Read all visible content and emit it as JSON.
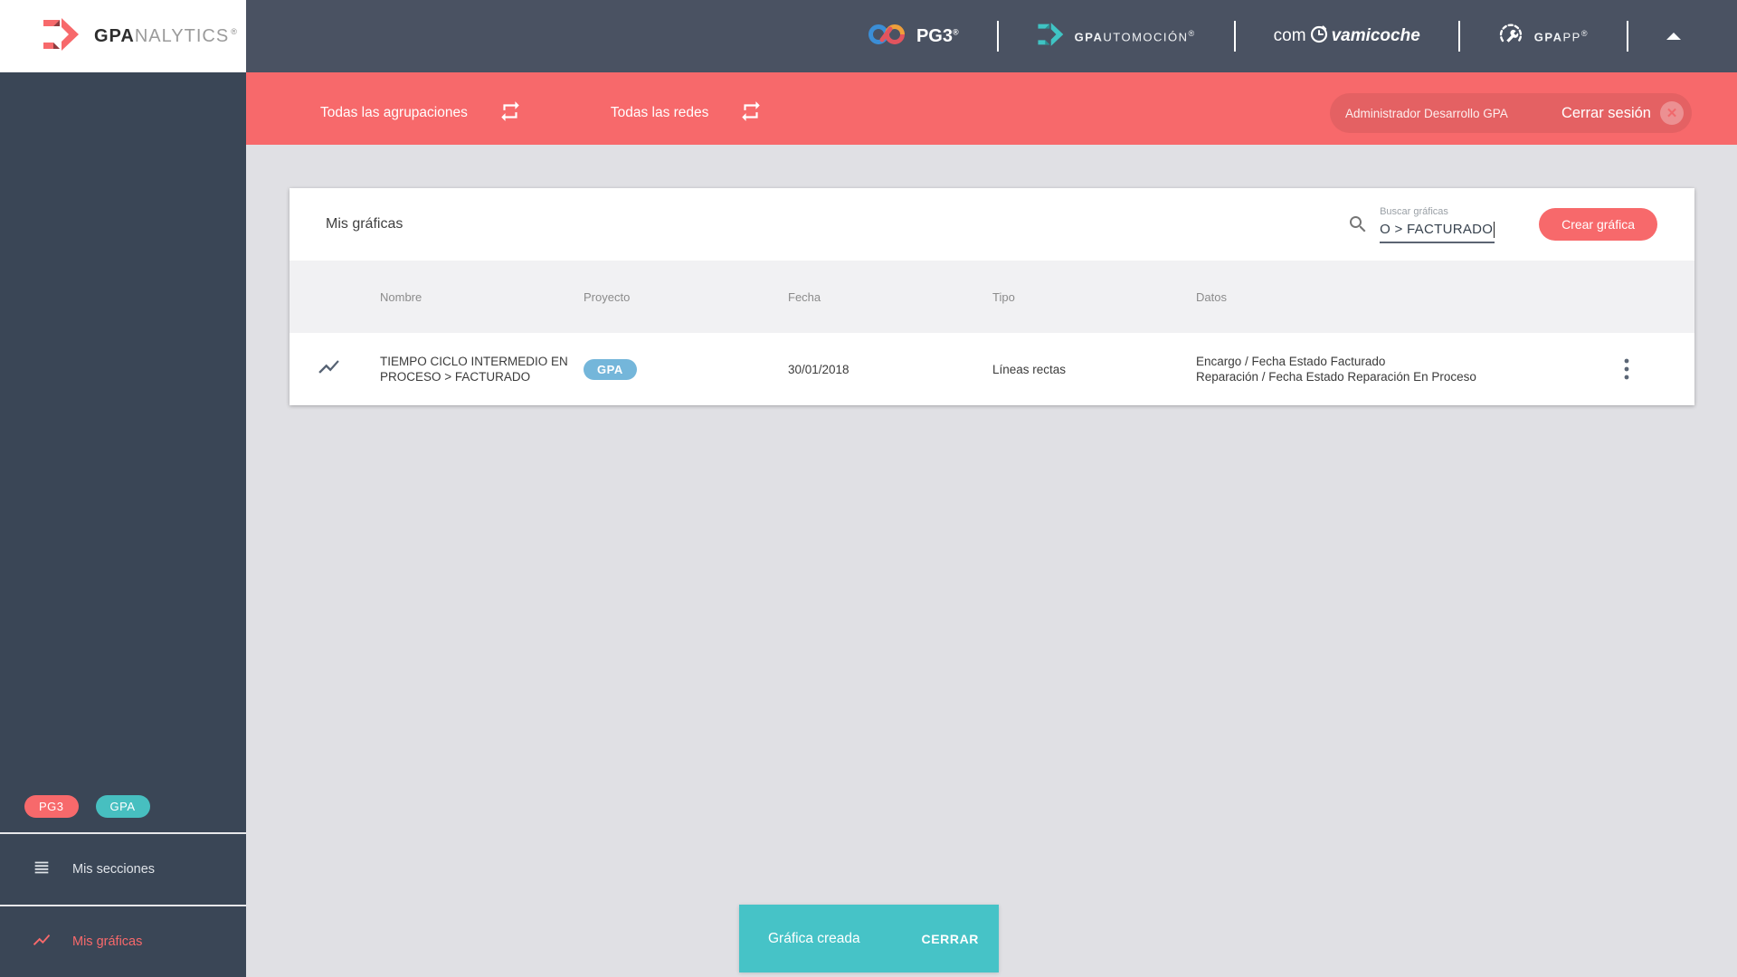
{
  "topbar": {
    "brand": {
      "bold": "GPA",
      "rest": "NALYTICS",
      "registered": "®"
    },
    "pg3": {
      "label": "PG3",
      "registered": "®"
    },
    "gpautomocion": {
      "bold": "GPA",
      "rest": "UTOMOCIÓN",
      "registered": "®"
    },
    "comprovamicoche": {
      "pre": "com",
      "post": "vamicoche"
    },
    "gpapp": {
      "bold": "GPA",
      "rest": "PP",
      "registered": "®"
    }
  },
  "filterbar": {
    "groupings": "Todas las agrupaciones",
    "networks": "Todas las redes",
    "user": "Administrador Desarrollo GPA",
    "logout": "Cerrar sesión",
    "close_x": "✕"
  },
  "sidebar": {
    "badges": [
      {
        "label": "PG3"
      },
      {
        "label": "GPA"
      }
    ],
    "items": [
      {
        "label": "Mis secciones"
      },
      {
        "label": "Mis gráficas"
      }
    ]
  },
  "content": {
    "title": "Mis gráficas",
    "search_label": "Buscar gráficas",
    "search_value": "O > FACTURADO",
    "create_button": "Crear gráfica",
    "table": {
      "headers": [
        "Nombre",
        "Proyecto",
        "Fecha",
        "Tipo",
        "Datos"
      ],
      "rows": [
        {
          "name_line1": "TIEMPO CICLO INTERMEDIO EN",
          "name_line2": "PROCESO > FACTURADO",
          "project_badge": "GPA",
          "date": "30/01/2018",
          "type": "Líneas rectas",
          "data_line1": "Encargo / Fecha Estado Facturado",
          "data_line2": "Reparación / Fecha Estado Reparación En Proceso"
        }
      ]
    }
  },
  "snackbar": {
    "message": "Gráfica creada",
    "action": "CERRAR"
  },
  "colors": {
    "accent_red": "#f7696b",
    "snackbar_teal": "#46c3c7",
    "badge_teal": "#47bfc0",
    "project_badge_blue": "#74b6da",
    "topbar_slate": "#4a5262",
    "sidebar_navy": "#3a4656",
    "background_gray": "#e0e0e4"
  }
}
